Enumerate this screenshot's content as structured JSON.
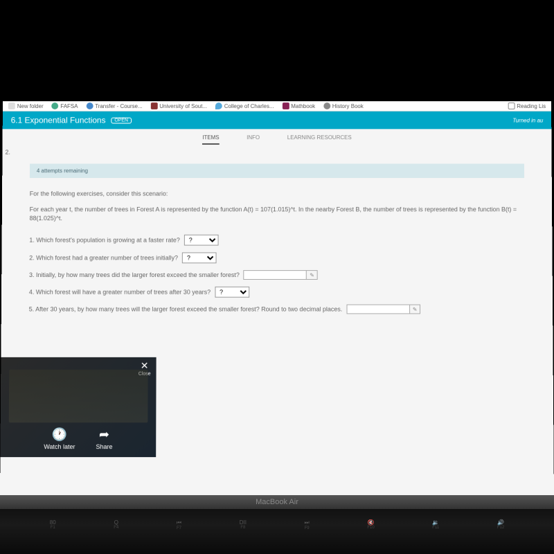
{
  "bookmarks": {
    "newfolder": "New folder",
    "fafsa": "FAFSA",
    "transfer": "Transfer - Course...",
    "university": "University of Sout...",
    "college": "College of Charles...",
    "mathbook": "Mathbook",
    "history": "History Book",
    "reading": "Reading Lis"
  },
  "header": {
    "title": "6.1 Exponential Functions",
    "badge": "OPEN",
    "status": "Turned in au"
  },
  "tabs": {
    "items": "ITEMS",
    "info": "INFO",
    "learning": "LEARNING RESOURCES"
  },
  "question_number": "2.",
  "attempts": "4 attempts remaining",
  "scenario": "For the following exercises, consider this scenario:",
  "formula": "For each year t, the number of trees in Forest A is represented by the function A(t) = 107(1.015)^t. In the nearby Forest B, the number of trees is represented by the function B(t) = 88(1.025)^t.",
  "questions": {
    "q1": "1. Which forest's population is growing at a faster rate?",
    "q2": "2. Which forest had a greater number of trees initially?",
    "q3": "3. Initially, by how many trees did the larger forest exceed the smaller forest?",
    "q4": "4. Which forest will have a greater number of trees after 30 years?",
    "q5": "5. After 30 years, by how many trees will the larger forest exceed the smaller forest? Round to two decimal places."
  },
  "select_placeholder": "?",
  "video": {
    "close": "Close",
    "watch_later": "Watch later",
    "share": "Share"
  },
  "laptop": {
    "label": "MacBook Air"
  },
  "keys": [
    "80",
    "Q",
    "DII",
    "F8",
    "F9",
    "DD"
  ]
}
